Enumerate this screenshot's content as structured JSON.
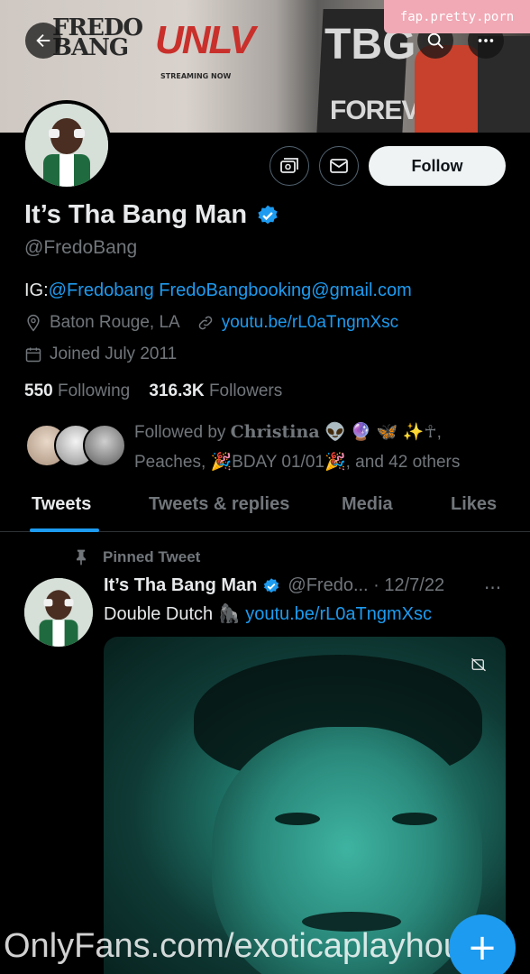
{
  "banner": {
    "title_line1": "FREDO",
    "title_line2": "BANG",
    "album": "UNLV",
    "streaming": "STREAMING NOW",
    "sign_top": "TBG",
    "sign_bottom": "FOREVER"
  },
  "watermark_top": "fap.pretty.porn",
  "profile": {
    "name": "It’s Tha Bang Man",
    "handle": "@FredoBang",
    "follow_label": "Follow",
    "bio_prefix": "IG:",
    "bio_link1": "@Fredobang",
    "bio_link2": "FredoBangbooking@gmail.com",
    "location": "Baton Rouge, LA",
    "website": "youtu.be/rL0aTngmXsc",
    "joined": "Joined July 2011",
    "following_count": "550",
    "following_label": "Following",
    "followers_count": "316.3K",
    "followers_label": "Followers",
    "followed_by_prefix": "Followed by",
    "followed_by_name": "Christina",
    "followed_by_rest": "👽 🔮 🦋 ✨☥, Peaches, 🎉BDAY 01/01🎉, and 42 others"
  },
  "tabs": [
    "Tweets",
    "Tweets & replies",
    "Media",
    "Likes"
  ],
  "pinned_tweet": {
    "pinned_label": "Pinned Tweet",
    "name": "It’s Tha Bang Man",
    "handle_date": "@Fredo... · 12/7/22",
    "text": "Double Dutch 🦍",
    "link": "youtu.be/rL0aTngmXsc",
    "more": "···"
  },
  "watermark_bottom": "OnlyFans.com/exoticaplayhouse",
  "fab_label": "+",
  "colors": {
    "background": "#000000",
    "accent": "#1d9bf0",
    "secondary_text": "#71767b",
    "primary_text": "#e7e9ea",
    "watermark_bg": "#f0a9b5"
  },
  "icons": [
    "back-arrow-icon",
    "search-icon",
    "more-icon",
    "subscribe-icon",
    "mail-icon",
    "verified-icon",
    "location-icon",
    "link-icon",
    "calendar-icon",
    "pin-icon",
    "sensitive-media-icon"
  ]
}
